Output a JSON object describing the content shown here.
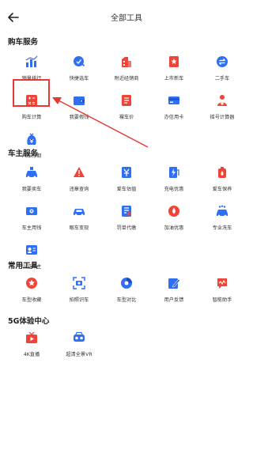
{
  "header": {
    "title": "全部工具"
  },
  "sections": [
    {
      "title": "购车服务",
      "items": [
        {
          "label": "销量排行",
          "icon": "sales-ranking-icon"
        },
        {
          "label": "快捷选车",
          "icon": "quick-pick-car-icon"
        },
        {
          "label": "附近经销商",
          "icon": "nearby-dealer-icon"
        },
        {
          "label": "上市新车",
          "icon": "new-car-launch-icon"
        },
        {
          "label": "二手车",
          "icon": "used-car-icon"
        },
        {
          "label": "购车计算",
          "icon": "car-purchase-calculator-icon"
        },
        {
          "label": "我要假钱",
          "icon": "wallet-icon"
        },
        {
          "label": "裸车价",
          "icon": "bare-car-price-icon"
        },
        {
          "label": "办信用卡",
          "icon": "credit-card-icon"
        },
        {
          "label": "摇号计算器",
          "icon": "lottery-calculator-icon"
        },
        {
          "label": "汽车分期",
          "icon": "car-installment-icon"
        }
      ]
    },
    {
      "title": "车主服务",
      "items": [
        {
          "label": "我要卖车",
          "icon": "sell-car-icon"
        },
        {
          "label": "违章查询",
          "icon": "violation-query-icon"
        },
        {
          "label": "爱车估值",
          "icon": "car-valuation-icon"
        },
        {
          "label": "充电优惠",
          "icon": "charging-discount-icon"
        },
        {
          "label": "爱车保养",
          "icon": "car-maintenance-icon"
        },
        {
          "label": "车主用钱",
          "icon": "owner-loan-icon"
        },
        {
          "label": "眼车变现",
          "icon": "car-cash-icon"
        },
        {
          "label": "罚单代缴",
          "icon": "fine-payment-icon"
        },
        {
          "label": "加油优惠",
          "icon": "fuel-discount-icon"
        },
        {
          "label": "专业洗车",
          "icon": "car-wash-icon"
        },
        {
          "label": "认证车主",
          "icon": "certified-owner-icon"
        }
      ]
    },
    {
      "title": "常用工具",
      "items": [
        {
          "label": "车型收藏",
          "icon": "favorite-model-icon"
        },
        {
          "label": "拍照识车",
          "icon": "photo-recognize-icon"
        },
        {
          "label": "车型对比",
          "icon": "model-compare-icon"
        },
        {
          "label": "用户反馈",
          "icon": "feedback-icon"
        },
        {
          "label": "智能助手",
          "icon": "smart-assistant-icon"
        }
      ]
    },
    {
      "title": "5G体验中心",
      "items": [
        {
          "label": "4K直播",
          "icon": "4k-live-icon"
        },
        {
          "label": "超清全景VR",
          "icon": "vr-panorama-icon"
        }
      ]
    }
  ],
  "colors": {
    "blue": "#2f6ff5",
    "red": "#f04438",
    "highlight": "#e53935"
  }
}
